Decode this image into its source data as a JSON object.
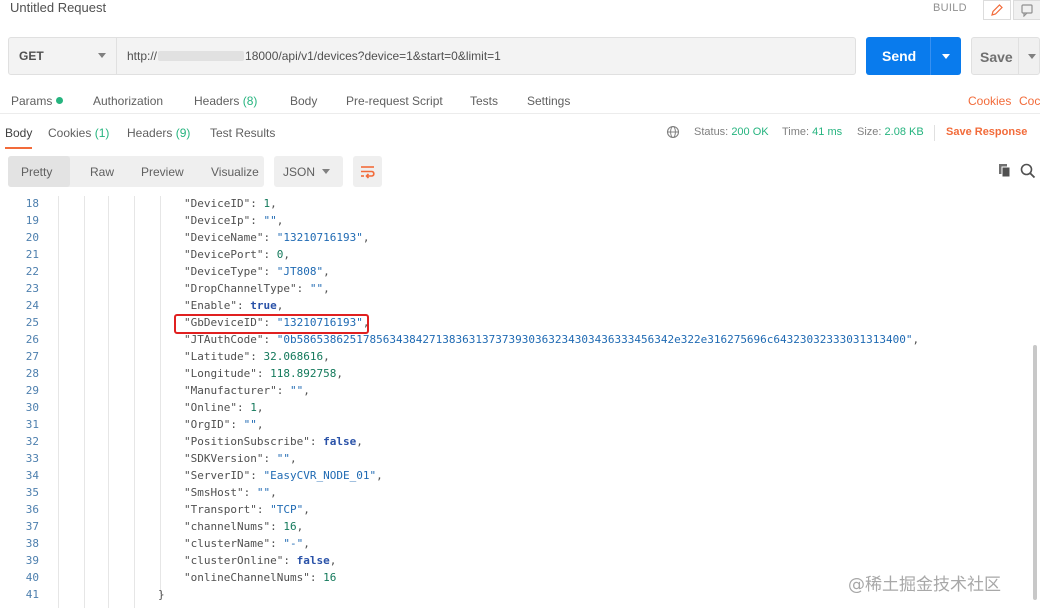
{
  "header": {
    "title": "Untitled Request",
    "build_label": "BUILD"
  },
  "request": {
    "method": "GET",
    "url_prefix": "http://",
    "url_suffix": "18000/api/v1/devices?device=1&start=0&limit=1",
    "send_label": "Send",
    "save_label": "Save"
  },
  "request_tabs": {
    "params": "Params",
    "authorization": "Authorization",
    "headers": "Headers",
    "headers_count": "(8)",
    "body": "Body",
    "prerequest": "Pre-request Script",
    "tests": "Tests",
    "settings": "Settings",
    "cookies": "Cookies",
    "code": "Coc"
  },
  "response_tabs": {
    "body": "Body",
    "cookies": "Cookies",
    "cookies_count": "(1)",
    "headers": "Headers",
    "headers_count": "(9)",
    "test_results": "Test Results"
  },
  "response_meta": {
    "status_label": "Status:",
    "status_value": "200 OK",
    "time_label": "Time:",
    "time_value": "41 ms",
    "size_label": "Size:",
    "size_value": "2.08 KB",
    "save_response": "Save Response"
  },
  "view": {
    "options": [
      "Pretty",
      "Raw",
      "Preview",
      "Visualize"
    ],
    "format": "JSON"
  },
  "code_lines": [
    {
      "n": "18",
      "key": "\"DeviceID\"",
      "val": "1",
      "type": "n"
    },
    {
      "n": "19",
      "key": "\"DeviceIp\"",
      "val": "\"\"",
      "type": "s"
    },
    {
      "n": "20",
      "key": "\"DeviceName\"",
      "val": "\"13210716193\"",
      "type": "s"
    },
    {
      "n": "21",
      "key": "\"DevicePort\"",
      "val": "0",
      "type": "n"
    },
    {
      "n": "22",
      "key": "\"DeviceType\"",
      "val": "\"JT808\"",
      "type": "s"
    },
    {
      "n": "23",
      "key": "\"DropChannelType\"",
      "val": "\"\"",
      "type": "s"
    },
    {
      "n": "24",
      "key": "\"Enable\"",
      "val": "true",
      "type": "b"
    },
    {
      "n": "25",
      "key": "\"GbDeviceID\"",
      "val": "\"13210716193\"",
      "type": "s"
    },
    {
      "n": "26",
      "key": "\"JTAuthCode\"",
      "val": "\"0b586538625178563438427138363137373930363234303436333456342e322e316275696c64323032333031313400\"",
      "type": "s"
    },
    {
      "n": "27",
      "key": "\"Latitude\"",
      "val": "32.068616",
      "type": "n"
    },
    {
      "n": "28",
      "key": "\"Longitude\"",
      "val": "118.892758",
      "type": "n"
    },
    {
      "n": "29",
      "key": "\"Manufacturer\"",
      "val": "\"\"",
      "type": "s"
    },
    {
      "n": "30",
      "key": "\"Online\"",
      "val": "1",
      "type": "n"
    },
    {
      "n": "31",
      "key": "\"OrgID\"",
      "val": "\"\"",
      "type": "s"
    },
    {
      "n": "32",
      "key": "\"PositionSubscribe\"",
      "val": "false",
      "type": "b"
    },
    {
      "n": "33",
      "key": "\"SDKVersion\"",
      "val": "\"\"",
      "type": "s"
    },
    {
      "n": "34",
      "key": "\"ServerID\"",
      "val": "\"EasyCVR_NODE_01\"",
      "type": "s"
    },
    {
      "n": "35",
      "key": "\"SmsHost\"",
      "val": "\"\"",
      "type": "s"
    },
    {
      "n": "36",
      "key": "\"Transport\"",
      "val": "\"TCP\"",
      "type": "s"
    },
    {
      "n": "37",
      "key": "\"channelNums\"",
      "val": "16",
      "type": "n"
    },
    {
      "n": "38",
      "key": "\"clusterName\"",
      "val": "\"-\"",
      "type": "s"
    },
    {
      "n": "39",
      "key": "\"clusterOnline\"",
      "val": "false",
      "type": "b"
    },
    {
      "n": "40",
      "key": "\"onlineChannelNums\"",
      "val": "16",
      "type": "n",
      "last": true
    },
    {
      "n": "41",
      "brace": "}"
    }
  ],
  "watermark": "@稀土掘金技术社区",
  "colors": {
    "send_blue": "#097bed",
    "accent_orange": "#f26b3a",
    "status_green": "#26b47f",
    "highlight_red": "#e02020"
  }
}
